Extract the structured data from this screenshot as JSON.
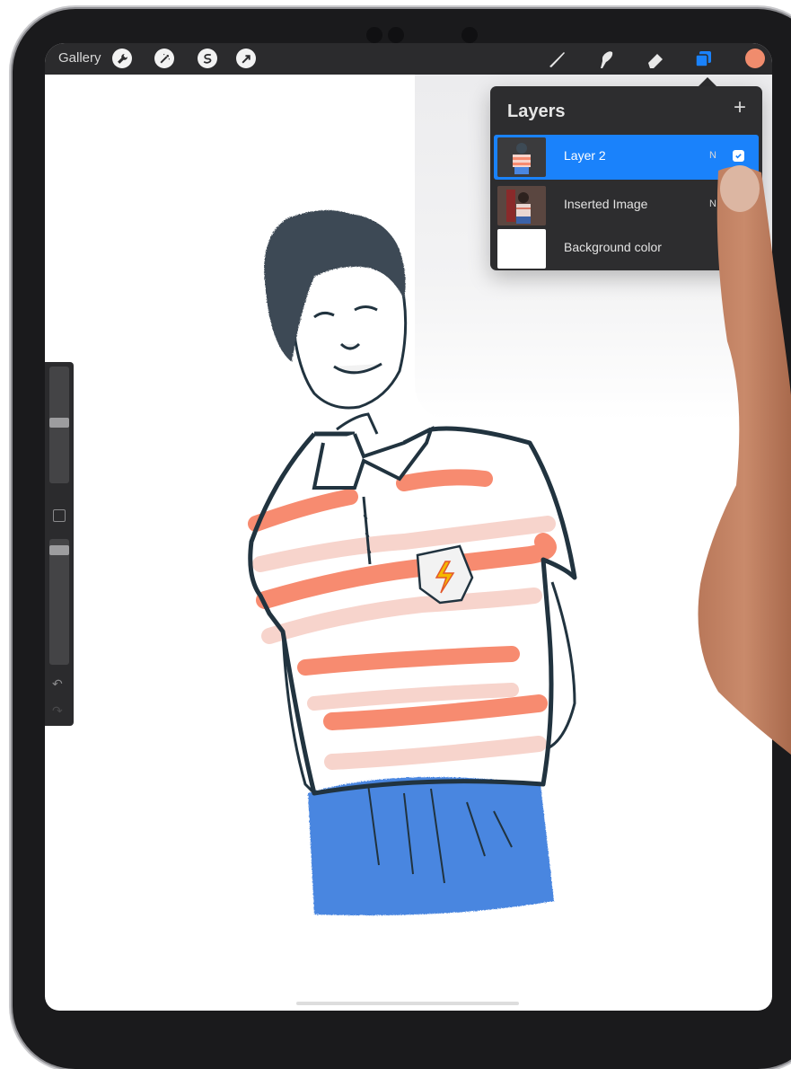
{
  "toolbar": {
    "gallery_label": "Gallery",
    "left_tools": [
      "wrench-icon",
      "magic-wand-icon",
      "selection-icon",
      "transform-arrow-icon"
    ],
    "right_tools": [
      "brush-icon",
      "smudge-icon",
      "eraser-icon",
      "layers-icon"
    ],
    "current_color": "#f08c6d",
    "active_tool": "layers"
  },
  "layers_panel": {
    "title": "Layers",
    "add_label": "+",
    "layers": [
      {
        "name": "Layer 2",
        "blend_mode": "N",
        "visible": true,
        "selected": true
      },
      {
        "name": "Inserted Image",
        "blend_mode": "N",
        "visible": true,
        "selected": false
      },
      {
        "name": "Background color",
        "selected": false
      }
    ]
  },
  "sidebar": {
    "brush_size_level": 0.35,
    "opacity_level": 0.05
  },
  "colors": {
    "toolbar_bg": "#2b2b2d",
    "panel_bg": "#2d2d2f",
    "selected_layer": "#1a82fb",
    "shirt_stripe": "#f78b70",
    "shirt_stripe_light": "#f7d4cc",
    "pants": "#4a86e0",
    "outline": "#21333f"
  }
}
